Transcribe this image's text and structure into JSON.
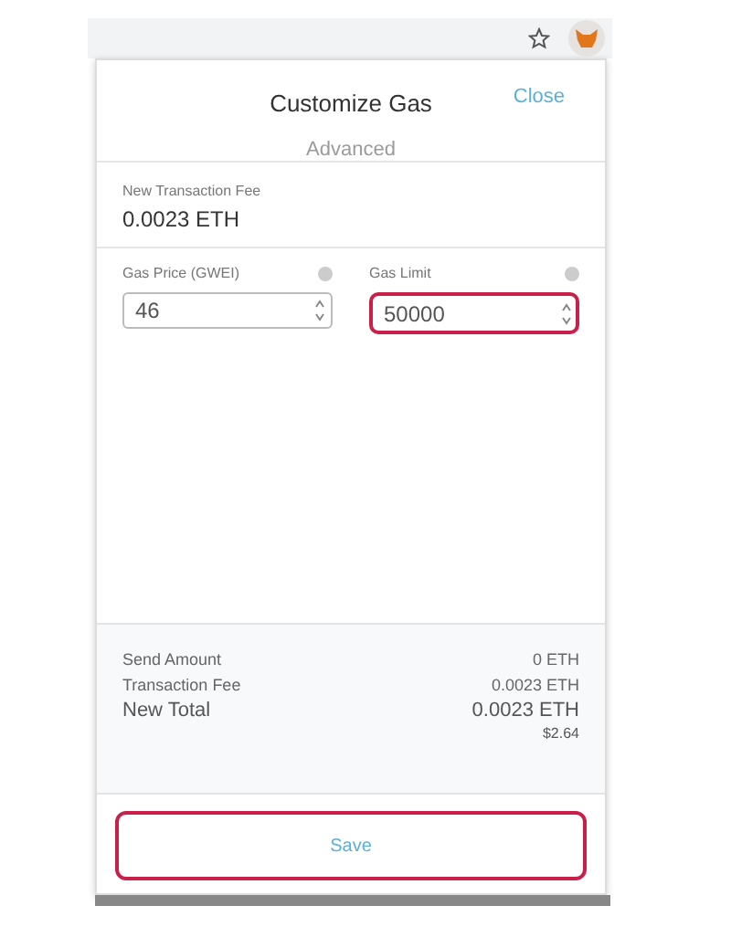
{
  "header": {
    "title": "Customize Gas",
    "close": "Close",
    "subtitle": "Advanced"
  },
  "fee": {
    "label": "New Transaction Fee",
    "value": "0.0023 ETH"
  },
  "fields": [
    {
      "label": "Gas Price (GWEI)",
      "value": "46",
      "highlighted": false
    },
    {
      "label": "Gas Limit",
      "value": "50000",
      "highlighted": true
    }
  ],
  "summary": [
    {
      "label": "Send Amount",
      "value": "0 ETH",
      "kind": "small"
    },
    {
      "label": "Transaction Fee",
      "value": "0.0023 ETH",
      "kind": "small"
    },
    {
      "label": "New Total",
      "value": "0.0023 ETH",
      "kind": "total"
    }
  ],
  "fiat": "$2.64",
  "save": {
    "label": "Save",
    "highlighted": true
  }
}
